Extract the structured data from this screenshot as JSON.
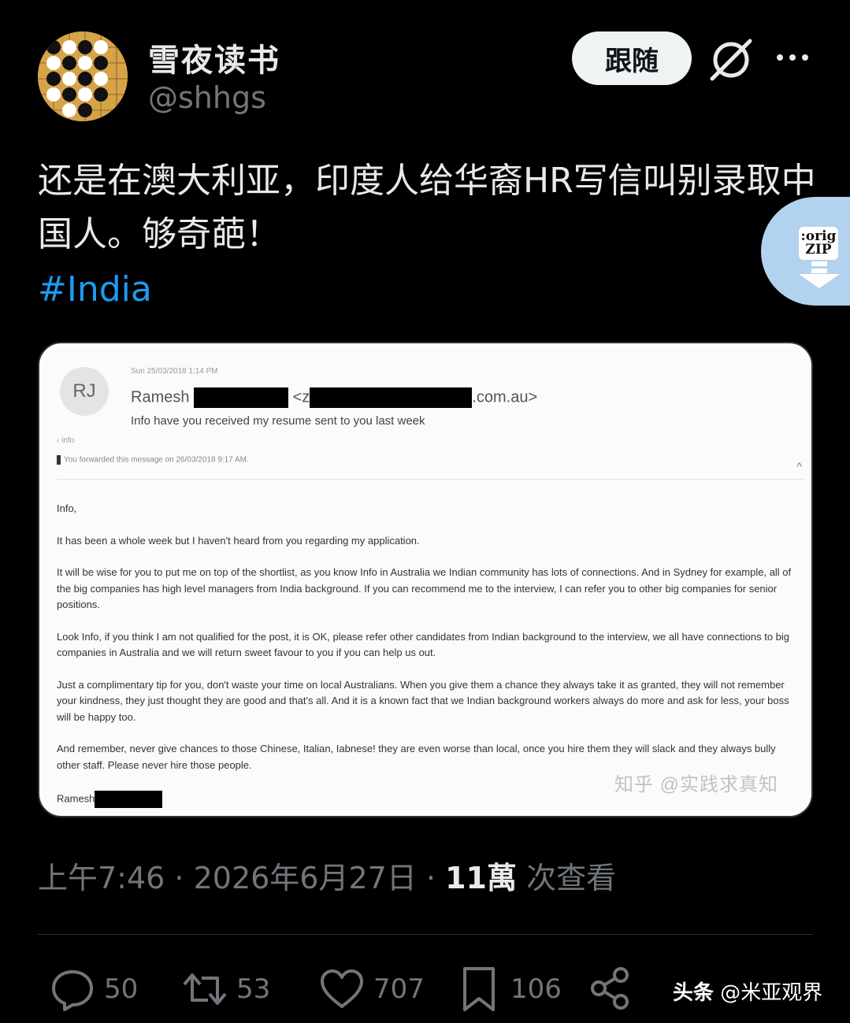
{
  "author": {
    "display_name": "雪夜读书",
    "handle": "@shhgs",
    "avatar_icon": "go-board-avatar"
  },
  "header": {
    "follow_label": "跟随",
    "grok_icon": "grok-icon",
    "more_icon": "more-icon"
  },
  "tweet": {
    "text": "还是在澳大利亚，印度人给华裔HR写信叫别录取中国人。够奇葩！",
    "hashtag": "#India"
  },
  "overlay": {
    "zip_label": ":orig ZIP",
    "zip_icon": "download-arrow-icon"
  },
  "email": {
    "avatar_initials": "RJ",
    "date": "Sun 25/03/2018 1:14 PM",
    "sender_name": "Ramesh",
    "sender_email_prefix": "<z",
    "sender_email_suffix": ".com.au>",
    "subject": "Info have you received my resume sent to you last week",
    "info_tag": "‹ info",
    "forwarded": "You forwarded this message on 26/03/2018 9:17 AM.",
    "greeting": "Info,",
    "paragraphs": [
      "It has been a whole week but I haven't heard from you regarding my application.",
      "It will be wise for you to put me on top of the shortlist, as you know Info in Australia we Indian community has lots of connections. And in Sydney for example, all of the big companies has high level managers from India background. If you can recommend me to the interview, I can refer you to other big companies for senior positions.",
      "Look Info, if you think I am not qualified for the post, it is OK, please refer other candidates from Indian background to the interview, we all have connections to big companies in Australia and we will return sweet favour to you if you can help us out.",
      "Just a complimentary tip for you, don't waste your time on local Australians. When you give them a chance they always take it as granted, they will not remember your kindness, they just thought they are good and that's all. And it is a known fact that we Indian background workers always do more and ask for less, your boss will be happy too.",
      "And remember, never give chances to those Chinese, Italian, Iabnese! they are even worse than local, once you hire them they will slack and they always bully other staff. Please never hire those people."
    ],
    "signature": "Ramesh",
    "watermark": "知乎 @实践求真知"
  },
  "meta": {
    "time": "上午7:46",
    "dot1": " · ",
    "date": "2026年6月27日",
    "dot2": " · ",
    "views_count": "11萬",
    "views_label": " 次查看"
  },
  "actions": {
    "reply_count": "50",
    "retweet_count": "53",
    "like_count": "707",
    "bookmark_count": "106"
  },
  "watermark_bottom": {
    "brand": "头条",
    "account": " @米亚观界"
  }
}
